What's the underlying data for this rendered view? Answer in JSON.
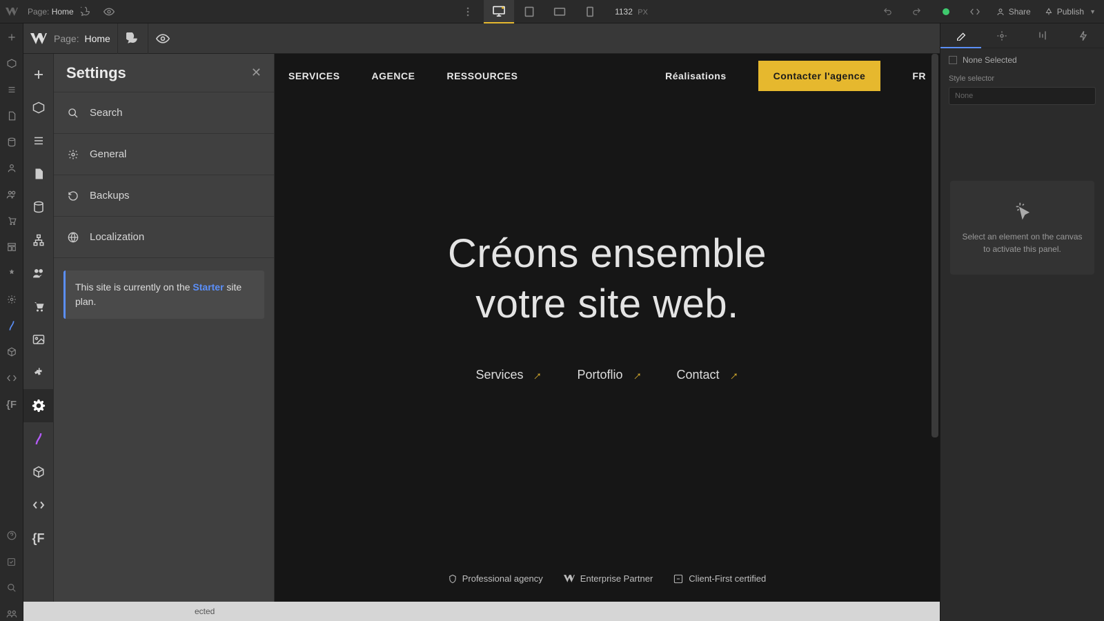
{
  "outerTopbar": {
    "pagePrefix": "Page:",
    "pageName": "Home",
    "width": "1132",
    "widthUnit": "PX",
    "share": "Share",
    "publish": "Publish"
  },
  "innerTopbar": {
    "pagePrefix": "Page:",
    "pageName": "Home"
  },
  "settings": {
    "title": "Settings",
    "items": [
      {
        "icon": "search",
        "label": "Search"
      },
      {
        "icon": "gear",
        "label": "General"
      },
      {
        "icon": "backup",
        "label": "Backups"
      },
      {
        "icon": "globe",
        "label": "Localization"
      }
    ],
    "notice": {
      "pre": "This site is currently on the ",
      "planLink": "Starter",
      "post": " site plan."
    }
  },
  "site": {
    "nav": {
      "services": "SERVICES",
      "agence": "AGENCE",
      "ressources": "RESSOURCES",
      "realisations": "Réalisations",
      "cta": "Contacter l'agence",
      "lang": "FR"
    },
    "hero": {
      "line1": "Créons ensemble",
      "line2": "votre site web.",
      "link1": "Services",
      "link2": "Portoflio",
      "link3": "Contact"
    },
    "badges": {
      "b1": "Professional agency",
      "b2": "Enterprise Partner",
      "b3": "Client-First certified"
    }
  },
  "statusbar": {
    "text": "ected"
  },
  "rightPanel": {
    "noneSelected": "None Selected",
    "styleSelectorLabel": "Style selector",
    "selectorPlaceholder": "None",
    "emptyMsg1": "Select an element on the canvas",
    "emptyMsg2": "to activate this panel."
  }
}
